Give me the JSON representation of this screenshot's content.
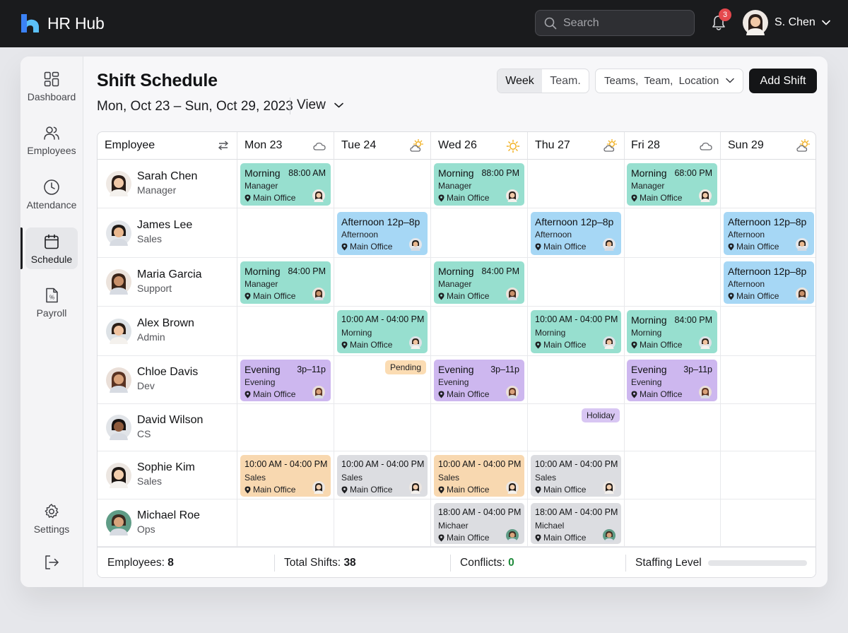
{
  "app": {
    "name": "HR Hub"
  },
  "topbar": {
    "search_placeholder": "Search",
    "notifications": "3",
    "user_name": "S. Chen"
  },
  "sidebar": {
    "items": [
      {
        "label": "Dashboard",
        "icon": "dashboard-icon"
      },
      {
        "label": "Employees",
        "icon": "users-icon"
      },
      {
        "label": "Attendance",
        "icon": "clock-icon"
      },
      {
        "label": "Schedule",
        "icon": "calendar-icon",
        "active": true
      },
      {
        "label": "Payroll",
        "icon": "payroll-icon"
      }
    ],
    "settings_label": "Settings"
  },
  "header": {
    "title": "Shift Schedule",
    "date_range": "Mon, Oct 23 – Sun, Oct 29, 2023",
    "view_label": "View",
    "toggle": {
      "week": "Week",
      "team": "Team."
    },
    "filter": "Teams,  Team,  Location",
    "add_button": "Add Shift"
  },
  "table": {
    "employee_header": "Employee",
    "days": [
      {
        "label": "Mon 23",
        "weather": "cloudy"
      },
      {
        "label": "Tue 24",
        "weather": "partly-sunny"
      },
      {
        "label": "Wed 26",
        "weather": "sunny"
      },
      {
        "label": "Thu 27",
        "weather": "partly-sunny"
      },
      {
        "label": "Fri 28",
        "weather": "cloudy"
      },
      {
        "label": "Sun 29",
        "weather": "partly-sunny"
      }
    ],
    "employees": [
      {
        "name": "Sarah Chen",
        "role": "Manager"
      },
      {
        "name": "James Lee",
        "role": "Sales"
      },
      {
        "name": "Maria Garcia",
        "role": "Support"
      },
      {
        "name": "Alex Brown",
        "role": "Admin"
      },
      {
        "name": "Chloe Davis",
        "role": "Dev"
      },
      {
        "name": "David Wilson",
        "role": "CS"
      },
      {
        "name": "Sophie Kim",
        "role": "Sales"
      },
      {
        "name": "Michael Roe",
        "role": "Ops"
      }
    ],
    "shifts": [
      {
        "row": 0,
        "day": 0,
        "color": "#97dfcf",
        "title": "Morning",
        "time": "88:00 AM",
        "sub": "Manager",
        "loc": "Main Office"
      },
      {
        "row": 0,
        "day": 2,
        "color": "#97dfcf",
        "title": "Morning",
        "time": "88:00 PM",
        "sub": "Manager",
        "loc": "Main Office"
      },
      {
        "row": 0,
        "day": 4,
        "color": "#97dfcf",
        "title": "Morning",
        "time": "68:00 PM",
        "sub": "Manager",
        "loc": "Main Office"
      },
      {
        "row": 1,
        "day": 1,
        "color": "#a6d7f5",
        "title": "Afternoon 12p–8p",
        "time": "",
        "sub": "Afternoon",
        "loc": "Main Office"
      },
      {
        "row": 1,
        "day": 3,
        "color": "#a6d7f5",
        "title": "Afternoon 12p–8p",
        "time": "",
        "sub": "Afternoon",
        "loc": "Main Office"
      },
      {
        "row": 1,
        "day": 5,
        "color": "#a6d7f5",
        "title": "Afternoon 12p–8p",
        "time": "",
        "sub": "Afternoon",
        "loc": "Main Office"
      },
      {
        "row": 2,
        "day": 0,
        "color": "#97dfcf",
        "title": "Morning",
        "time": "84:00 PM",
        "sub": "Manager",
        "loc": "Main Office"
      },
      {
        "row": 2,
        "day": 2,
        "color": "#97dfcf",
        "title": "Morning",
        "time": "84:00 PM",
        "sub": "Manager",
        "loc": "Main Office"
      },
      {
        "row": 2,
        "day": 5,
        "color": "#a6d7f5",
        "title": "Afternoon 12p–8p",
        "time": "",
        "sub": "Afternoon",
        "loc": "Main Office"
      },
      {
        "row": 3,
        "day": 1,
        "color": "#97dfcf",
        "full": "10:00 AM - 04:00 PM",
        "sub": "Morning",
        "loc": "Main Office"
      },
      {
        "row": 3,
        "day": 3,
        "color": "#97dfcf",
        "full": "10:00 AM - 04:00 PM",
        "sub": "Morning",
        "loc": "Main Office"
      },
      {
        "row": 3,
        "day": 4,
        "color": "#97dfcf",
        "title": "Morning",
        "time": "84:00 PM",
        "sub": "Morning",
        "loc": "Main Office"
      },
      {
        "row": 4,
        "day": 0,
        "color": "#cdb7ef",
        "title": "Evening",
        "time": "3p–11p",
        "sub": "Evening",
        "loc": "Main Office"
      },
      {
        "row": 4,
        "day": 2,
        "color": "#cdb7ef",
        "title": "Evening",
        "time": "3p–11p",
        "sub": "Evening",
        "loc": "Main Office"
      },
      {
        "row": 4,
        "day": 4,
        "color": "#cdb7ef",
        "title": "Evening",
        "time": "3p–11p",
        "sub": "Evening",
        "loc": "Main Office"
      },
      {
        "row": 6,
        "day": 0,
        "color": "#f8d8b0",
        "full": "10:00 AM - 04:00 PM",
        "sub": "Sales",
        "loc": "Main Office"
      },
      {
        "row": 6,
        "day": 1,
        "color": "#dcdde1",
        "full": "10:00 AM - 04:00 PM",
        "sub": "Sales",
        "loc": "Main Office"
      },
      {
        "row": 6,
        "day": 2,
        "color": "#f8d8b0",
        "full": "10:00 AM - 04:00 PM",
        "sub": "Sales",
        "loc": "Main Office"
      },
      {
        "row": 6,
        "day": 3,
        "color": "#dcdde1",
        "full": "10:00 AM - 04:00 PM",
        "sub": "Sales",
        "loc": "Main Office"
      },
      {
        "row": 7,
        "day": 2,
        "color": "#dcdde1",
        "full": "18:00 AM - 04:00 PM",
        "sub": "Michaer",
        "loc": "Main Office"
      },
      {
        "row": 7,
        "day": 3,
        "color": "#dcdde1",
        "full": "18:00 AM - 04:00 PM",
        "sub": "Michael",
        "loc": "Main Office"
      }
    ],
    "tags": [
      {
        "row": 4,
        "day": 1,
        "label": "Pending",
        "color": "#fbdcb3"
      },
      {
        "row": 5,
        "day": 3,
        "label": "Holiday",
        "color": "#d8c6f3"
      }
    ]
  },
  "footer": {
    "employees_label": "Employees:",
    "employees_value": "8",
    "shifts_label": "Total Shifts:",
    "shifts_value": "38",
    "conflicts_label": "Conflicts:",
    "conflicts_value": "0",
    "staffing_label": "Staffing Level",
    "staffing_level": 0
  },
  "colors": {
    "topbar": "#1a1b1d",
    "accent_button": "#141517",
    "morning": "#97dfcf",
    "afternoon": "#a6d7f5",
    "evening": "#cdb7ef",
    "sales": "#f8d8b0",
    "neutral": "#dcdde1",
    "conflicts_ok": "#1f8a3b"
  }
}
